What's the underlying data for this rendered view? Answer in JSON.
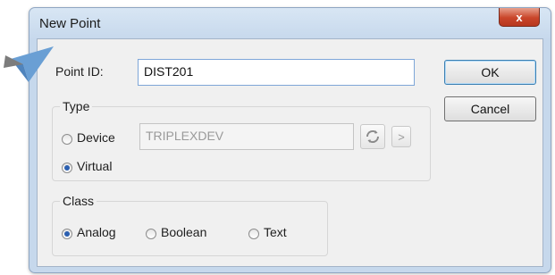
{
  "window": {
    "title": "New Point",
    "close_symbol": "x"
  },
  "point_id": {
    "label": "Point ID:",
    "value": "DIST201"
  },
  "type_group": {
    "legend": "Type",
    "device_label": "Device",
    "device_value": "TRIPLEXDEV",
    "virtual_label": "Virtual",
    "selected": "Virtual",
    "browse_icon": "refresh-icon",
    "more_label": ">"
  },
  "class_group": {
    "legend": "Class",
    "options": [
      "Analog",
      "Boolean",
      "Text"
    ],
    "selected": "Analog"
  },
  "buttons": {
    "ok": "OK",
    "cancel": "Cancel"
  },
  "colors": {
    "accent": "#2b5fb0",
    "close": "#c9452a",
    "cursor": "#6a9fd4"
  }
}
